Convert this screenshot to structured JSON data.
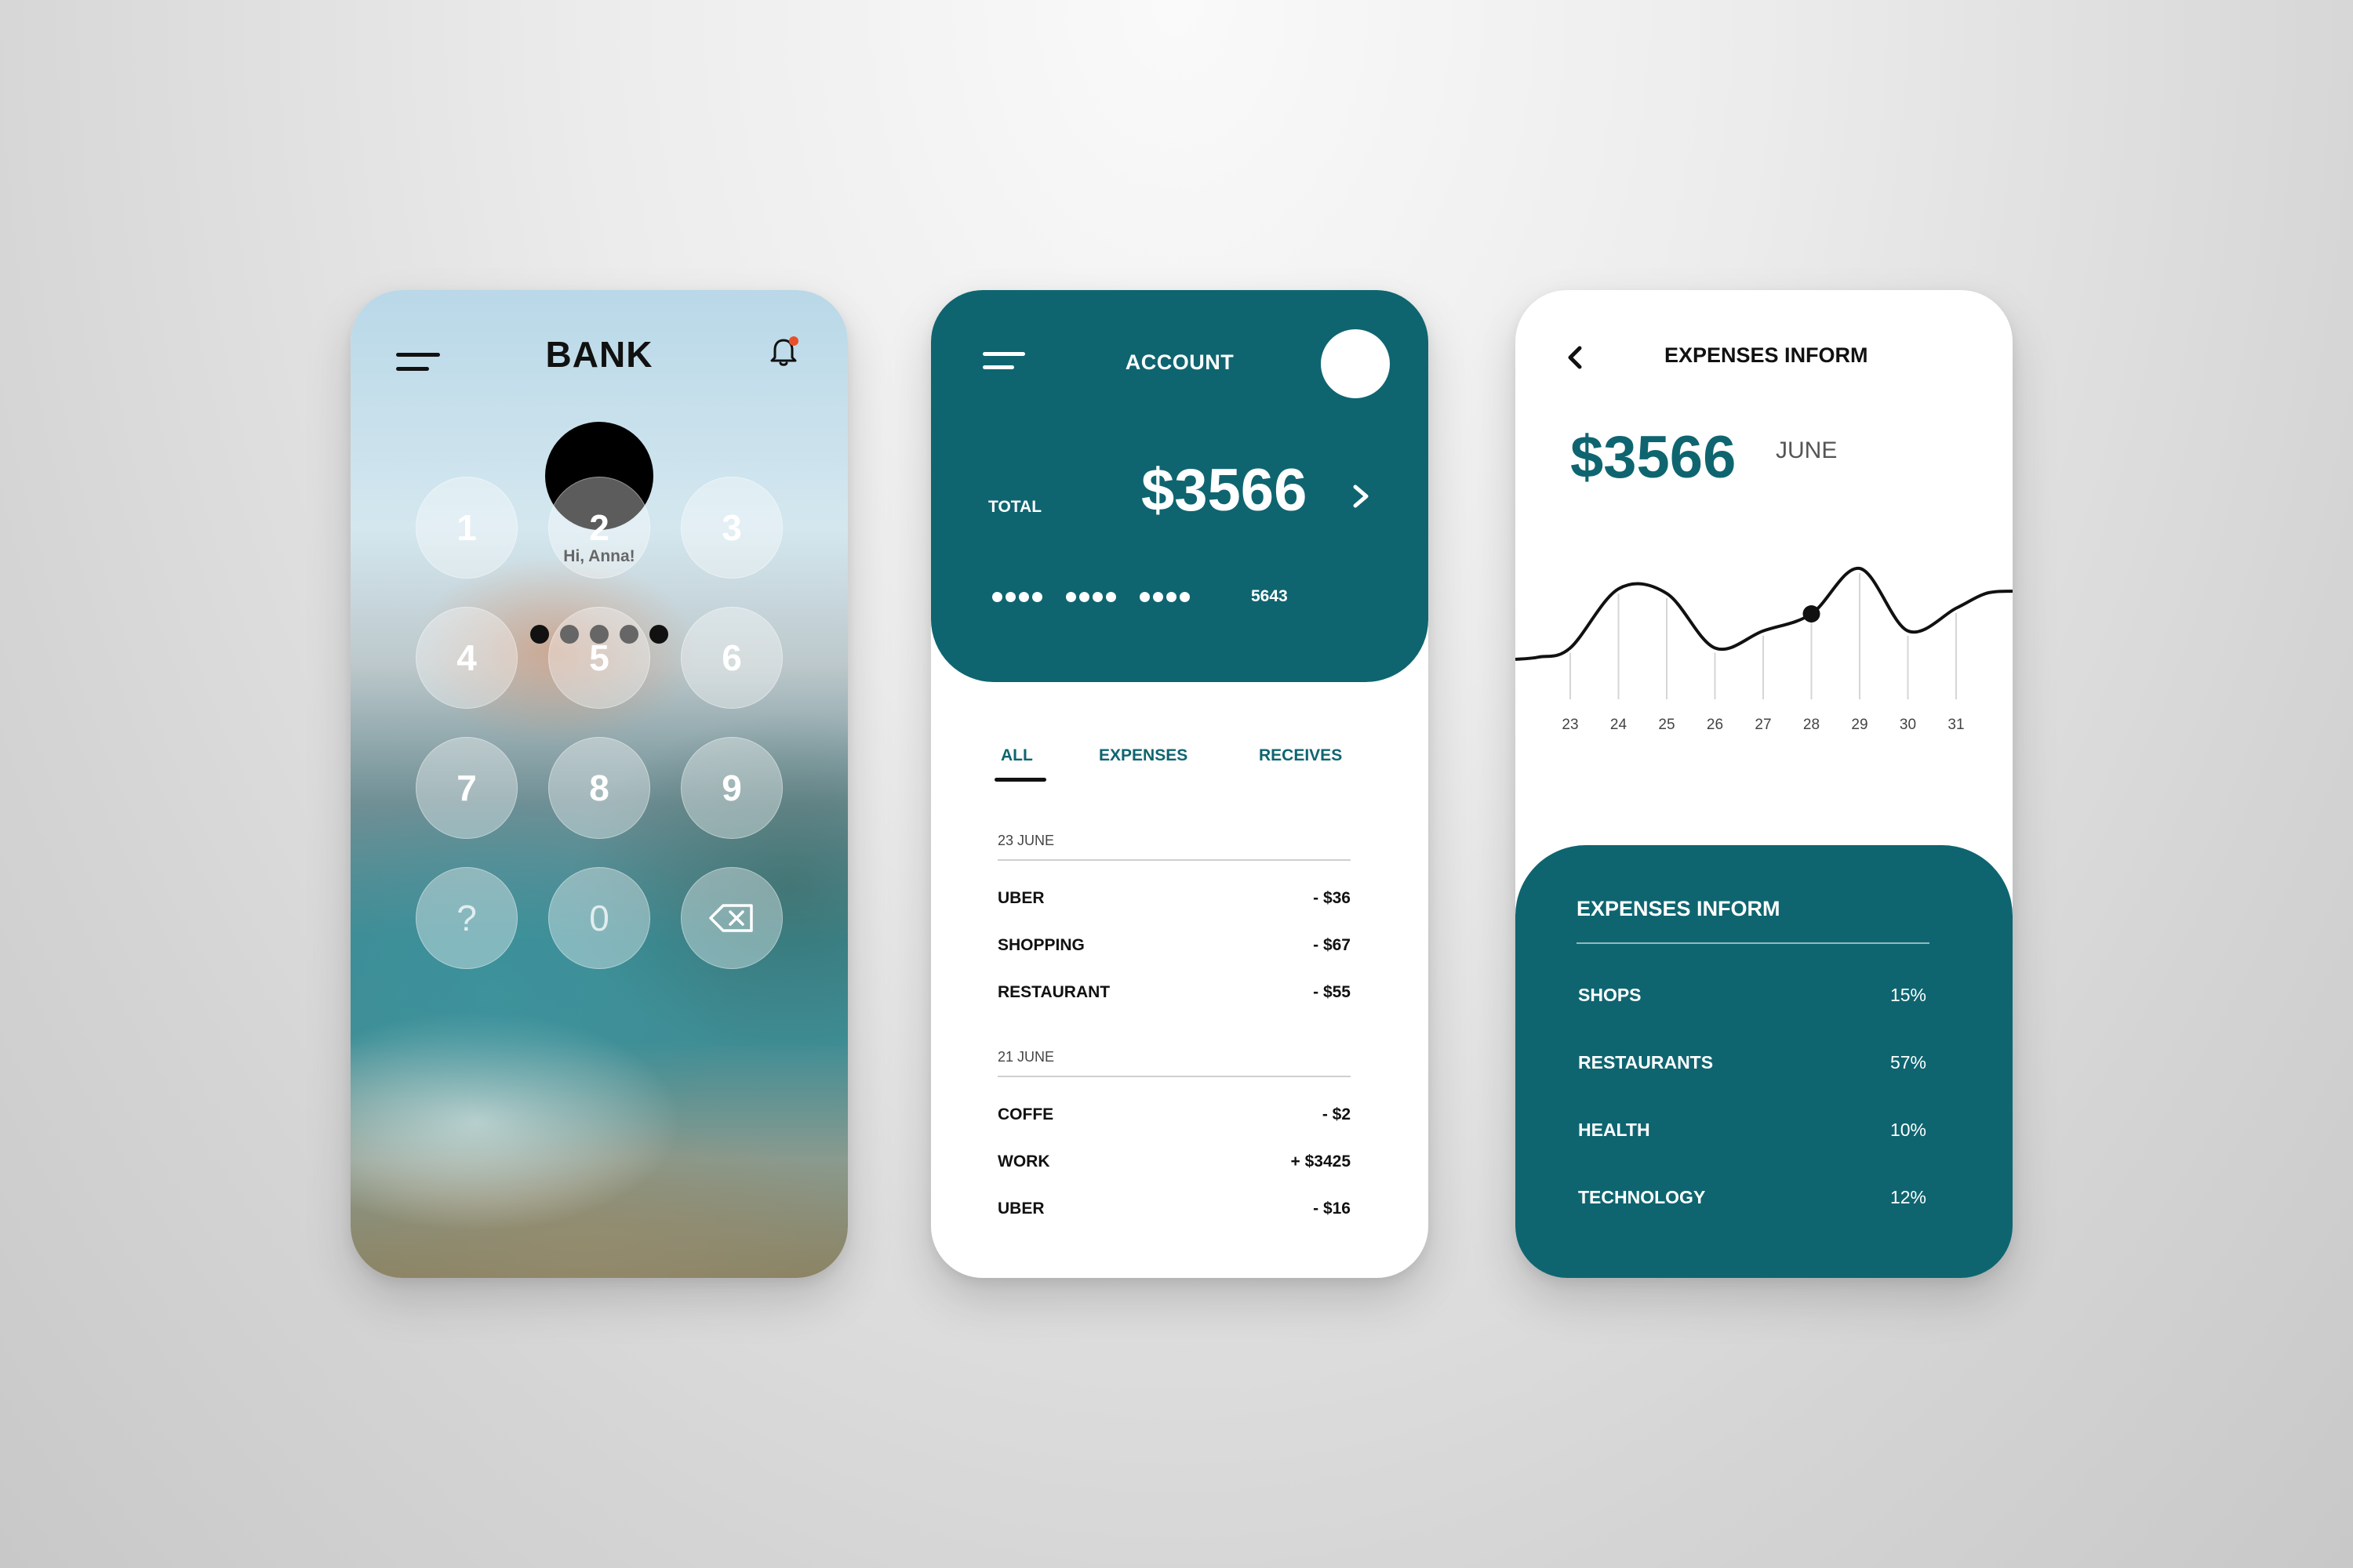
{
  "lock_screen": {
    "title": "BANK",
    "greeting": "Hi, Anna!",
    "pin_dot_count": 5,
    "keypad": [
      "1",
      "2",
      "3",
      "4",
      "5",
      "6",
      "7",
      "8",
      "9",
      "?",
      "0",
      "backspace"
    ]
  },
  "account": {
    "title": "ACCOUNT",
    "total_label": "TOTAL",
    "total_amount": "$3566",
    "card_last_digits": "5643",
    "tabs": [
      "ALL",
      "EXPENSES",
      "RECEIVES"
    ],
    "active_tab": "ALL",
    "groups": [
      {
        "date": "23 JUNE",
        "transactions": [
          {
            "name": "UBER",
            "amount": "- $36"
          },
          {
            "name": "SHOPPING",
            "amount": "- $67"
          },
          {
            "name": "RESTAURANT",
            "amount": "- $55"
          }
        ]
      },
      {
        "date": "21 JUNE",
        "transactions": [
          {
            "name": "COFFE",
            "amount": "- $2"
          },
          {
            "name": "WORK",
            "amount": "+ $3425"
          },
          {
            "name": "UBER",
            "amount": "- $16"
          }
        ]
      }
    ]
  },
  "expenses": {
    "title": "EXPENSES INFORM",
    "amount": "$3566",
    "month": "JUNE",
    "panel_title": "EXPENSES INFORM",
    "categories": [
      {
        "name": "SHOPS",
        "percent": "15%"
      },
      {
        "name": "RESTAURANTS",
        "percent": "57%"
      },
      {
        "name": "HEALTH",
        "percent": "10%"
      },
      {
        "name": "TECHNOLOGY",
        "percent": "12%"
      }
    ]
  },
  "chart_data": {
    "type": "line",
    "x": [
      23,
      24,
      25,
      26,
      27,
      28,
      29,
      30,
      31
    ],
    "xlabel": "",
    "ylabel": "",
    "series": [
      {
        "values": [
          30,
          82,
          78,
          30,
          45,
          60,
          100,
          45,
          65
        ]
      }
    ],
    "highlighted_point": {
      "x": 28,
      "y": 60
    },
    "grid": "vertical lines at each x tick",
    "colors": {
      "line": "#111111",
      "grid": "#d6d6d6"
    }
  },
  "colors": {
    "accent": "#0e6570",
    "text": "#111111"
  }
}
